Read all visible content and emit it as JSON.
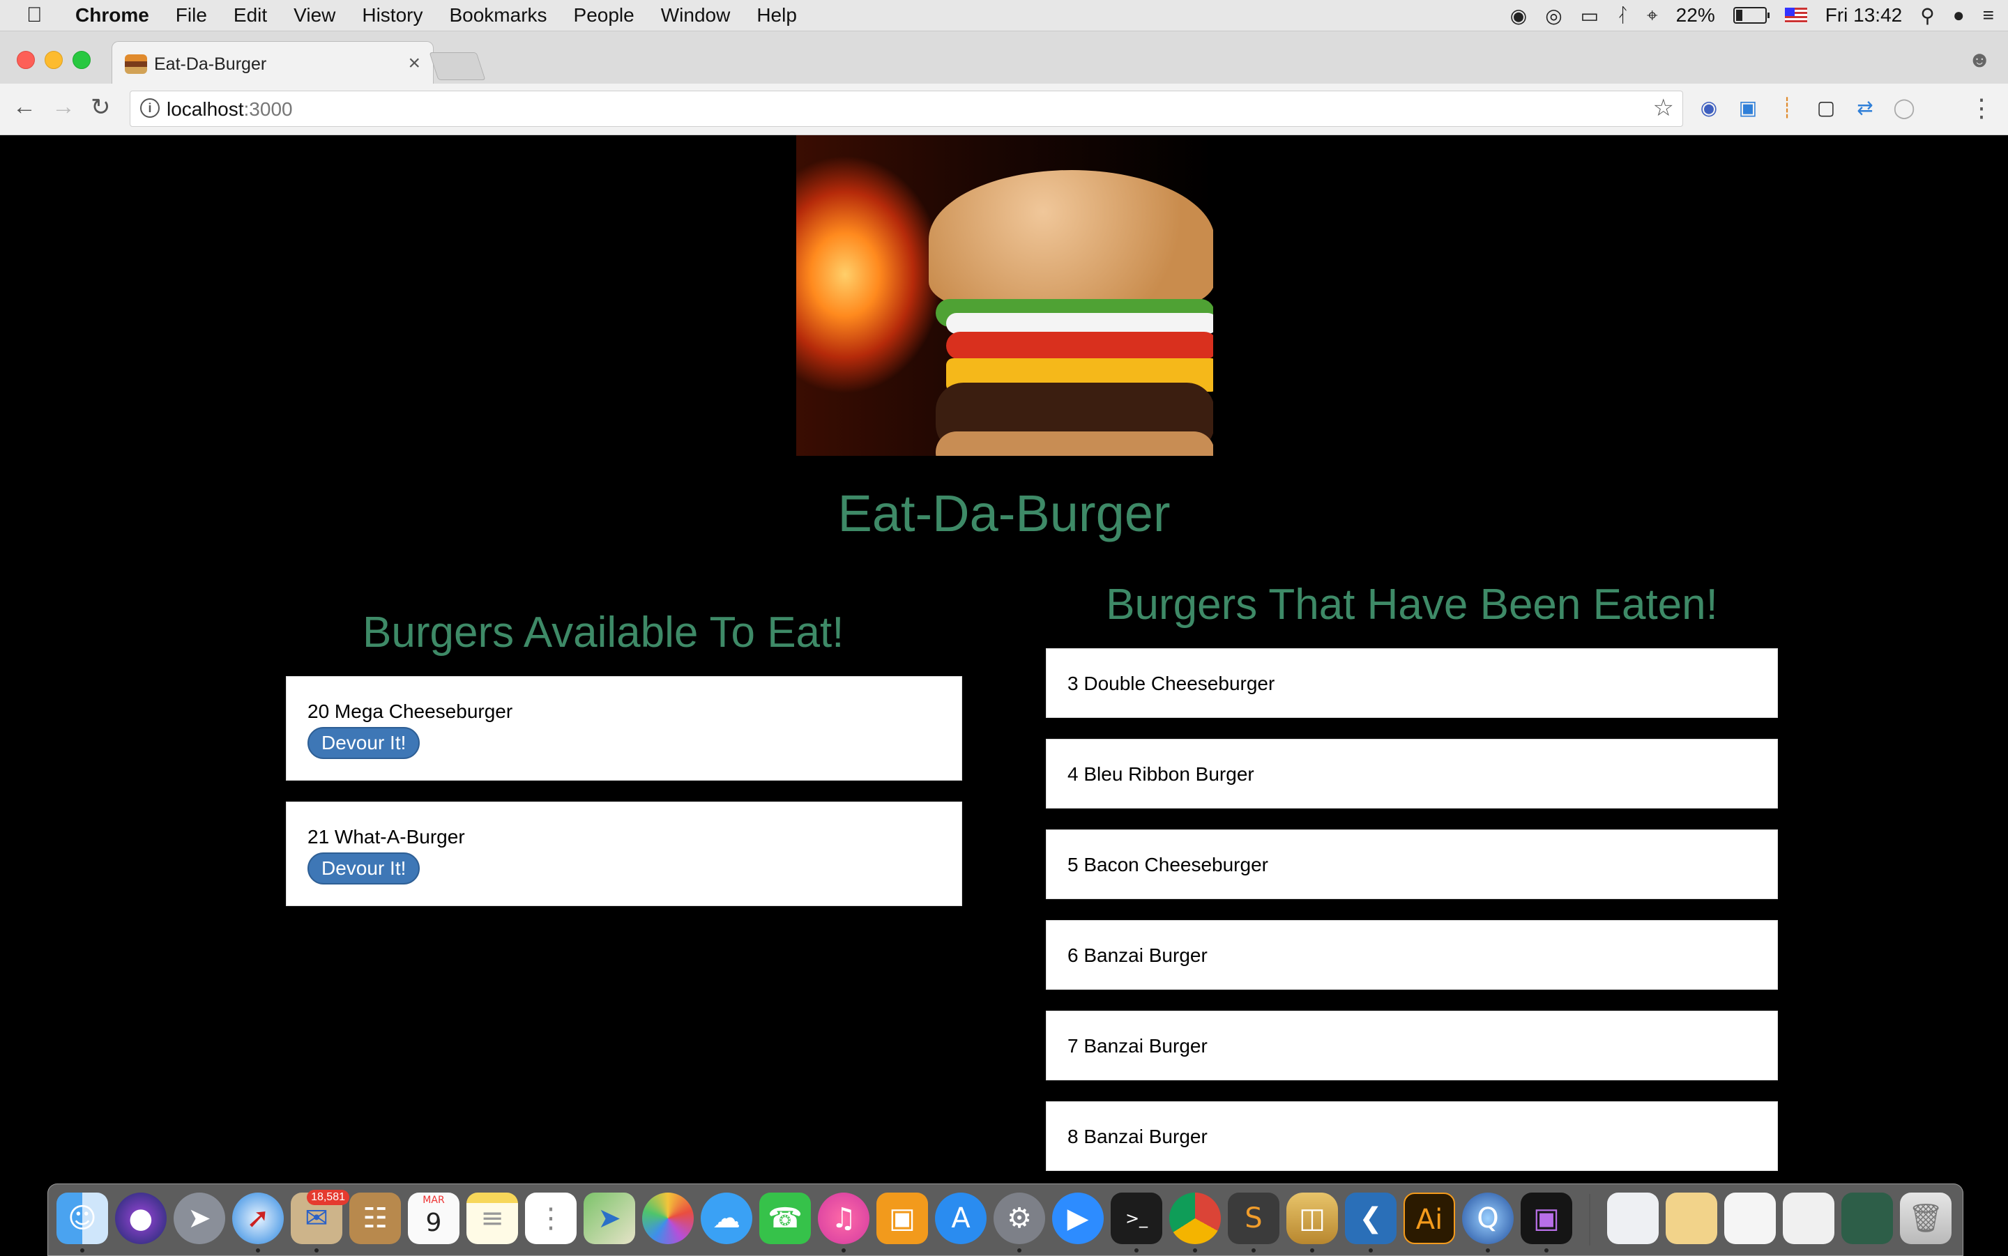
{
  "menubar": {
    "app": "Chrome",
    "items": [
      "File",
      "Edit",
      "View",
      "History",
      "Bookmarks",
      "People",
      "Window",
      "Help"
    ],
    "battery_percent": "22%",
    "battery_level": 0.22,
    "clock": "Fri 13:42"
  },
  "browser": {
    "tab_title": "Eat-Da-Burger",
    "tab_close": "×",
    "url_host": "localhost",
    "url_port": ":3000"
  },
  "page": {
    "title": "Eat-Da-Burger",
    "available_heading": "Burgers Available To Eat!",
    "eaten_heading": "Burgers That Have Been Eaten!",
    "devour_label": "Devour It!",
    "available": [
      {
        "label": "20 Mega Cheeseburger"
      },
      {
        "label": "21 What-A-Burger"
      }
    ],
    "eaten": [
      {
        "label": "3 Double Cheeseburger"
      },
      {
        "label": "4 Bleu Ribbon Burger"
      },
      {
        "label": "5 Bacon Cheeseburger"
      },
      {
        "label": "6 Banzai Burger"
      },
      {
        "label": "7 Banzai Burger"
      },
      {
        "label": "8 Banzai Burger"
      }
    ]
  },
  "dock": {
    "mail_badge": "18,581",
    "calendar_month": "MAR",
    "calendar_day": "9",
    "apps": [
      "finder-icon",
      "siri-icon",
      "launchpad-icon",
      "safari-icon",
      "mail-icon",
      "contacts-icon",
      "calendar-icon",
      "notes-icon",
      "reminders-icon",
      "maps-icon",
      "photos-icon",
      "messages-icon",
      "facetime-icon",
      "itunes-icon",
      "ibooks-icon",
      "app-store-icon",
      "system-preferences-icon",
      "zoom-icon",
      "terminal-icon",
      "chrome-icon",
      "sublime-icon",
      "sequel-pro-icon",
      "vscode-icon",
      "illustrator-icon",
      "quicktime-icon",
      "screen-capture-icon"
    ]
  },
  "colors": {
    "heading_green": "#3e8a67",
    "button_blue": "#3e77b6",
    "page_bg": "#000000"
  }
}
